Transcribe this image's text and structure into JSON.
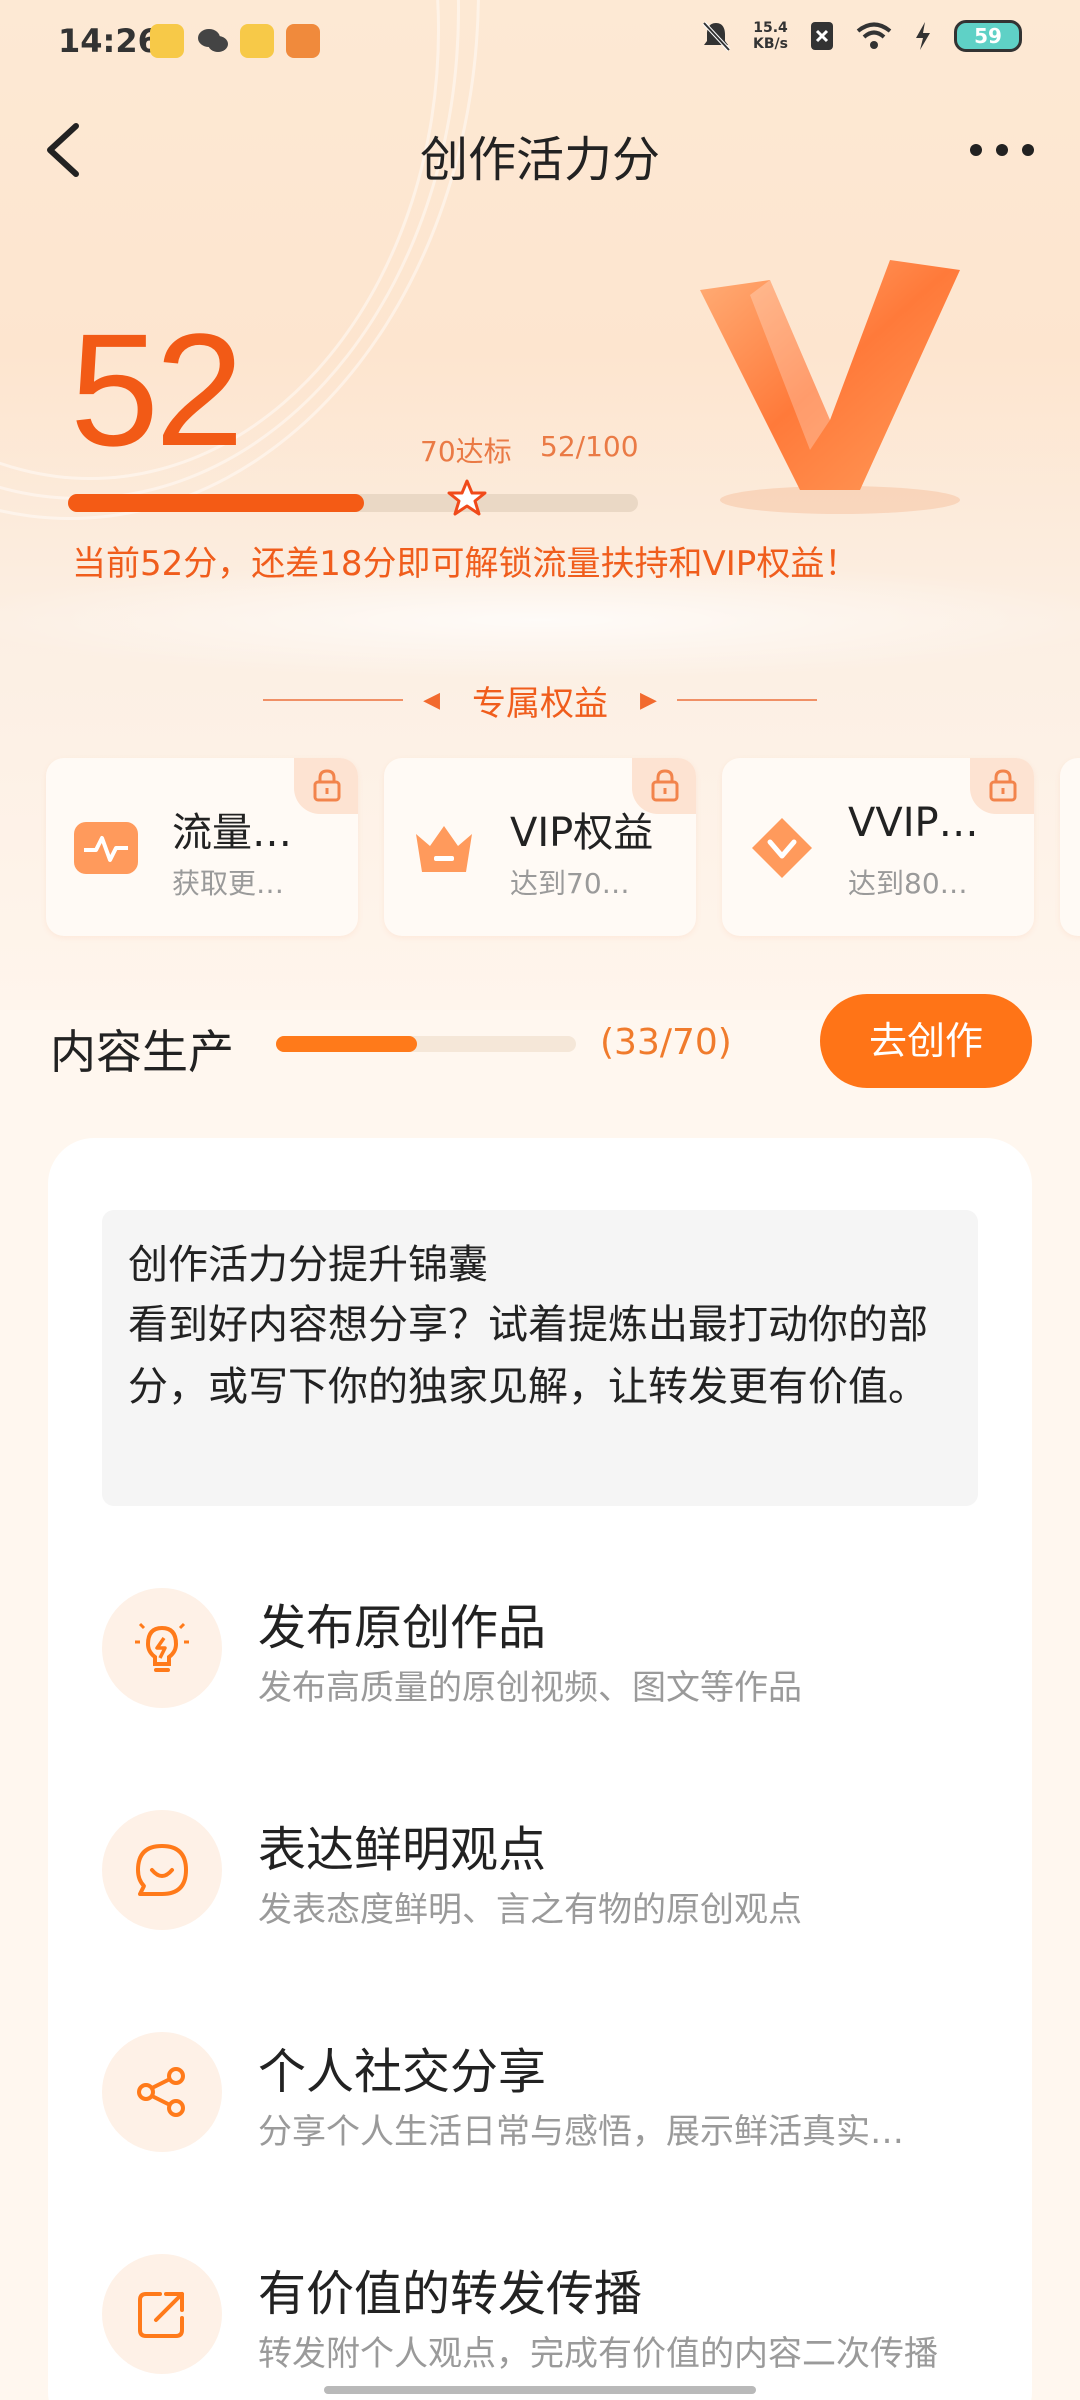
{
  "status_bar": {
    "time": "14:26",
    "net_speed_value": "15.4",
    "net_speed_unit": "KB/s",
    "battery": "59"
  },
  "header": {
    "title": "创作活力分"
  },
  "score": {
    "value": "52",
    "target_label": "70达标",
    "progress_label": "52/100",
    "progress": 0.52,
    "target_fraction": 0.7,
    "hint": "当前52分，还差18分即可解锁流量扶持和VIP权益！"
  },
  "benefits": {
    "title": "专属权益",
    "cards": [
      {
        "name": "流量…",
        "sub": "获取更…",
        "icon": "pulse-icon"
      },
      {
        "name": "VIP权益",
        "sub": "达到70…",
        "icon": "crown-icon"
      },
      {
        "name": "VVIP…",
        "sub": "达到80…",
        "icon": "diamond-icon"
      }
    ]
  },
  "production": {
    "label": "内容生产",
    "count": "(33/70)",
    "progress": 0.4714,
    "button": "去创作"
  },
  "tip": {
    "title": "创作活力分提升锦囊",
    "body": "看到好内容想分享？试着提炼出最打动你的部分，或写下你的独家见解，让转发更有价值。"
  },
  "tasks": [
    {
      "title": "发布原创作品",
      "desc": "发布高质量的原创视频、图文等作品",
      "icon": "lightbulb-icon"
    },
    {
      "title": "表达鲜明观点",
      "desc": "发表态度鲜明、言之有物的原创观点",
      "icon": "smile-bubble-icon"
    },
    {
      "title": "个人社交分享",
      "desc": "分享个人生活日常与感悟，展示鲜活真实…",
      "icon": "share-icon"
    },
    {
      "title": "有价值的转发传播",
      "desc": "转发附个人观点，完成有价值的内容二次传播",
      "icon": "forward-icon"
    }
  ],
  "colors": {
    "accent": "#f25a16",
    "button": "#ff7417",
    "background": "#fff7ef"
  }
}
